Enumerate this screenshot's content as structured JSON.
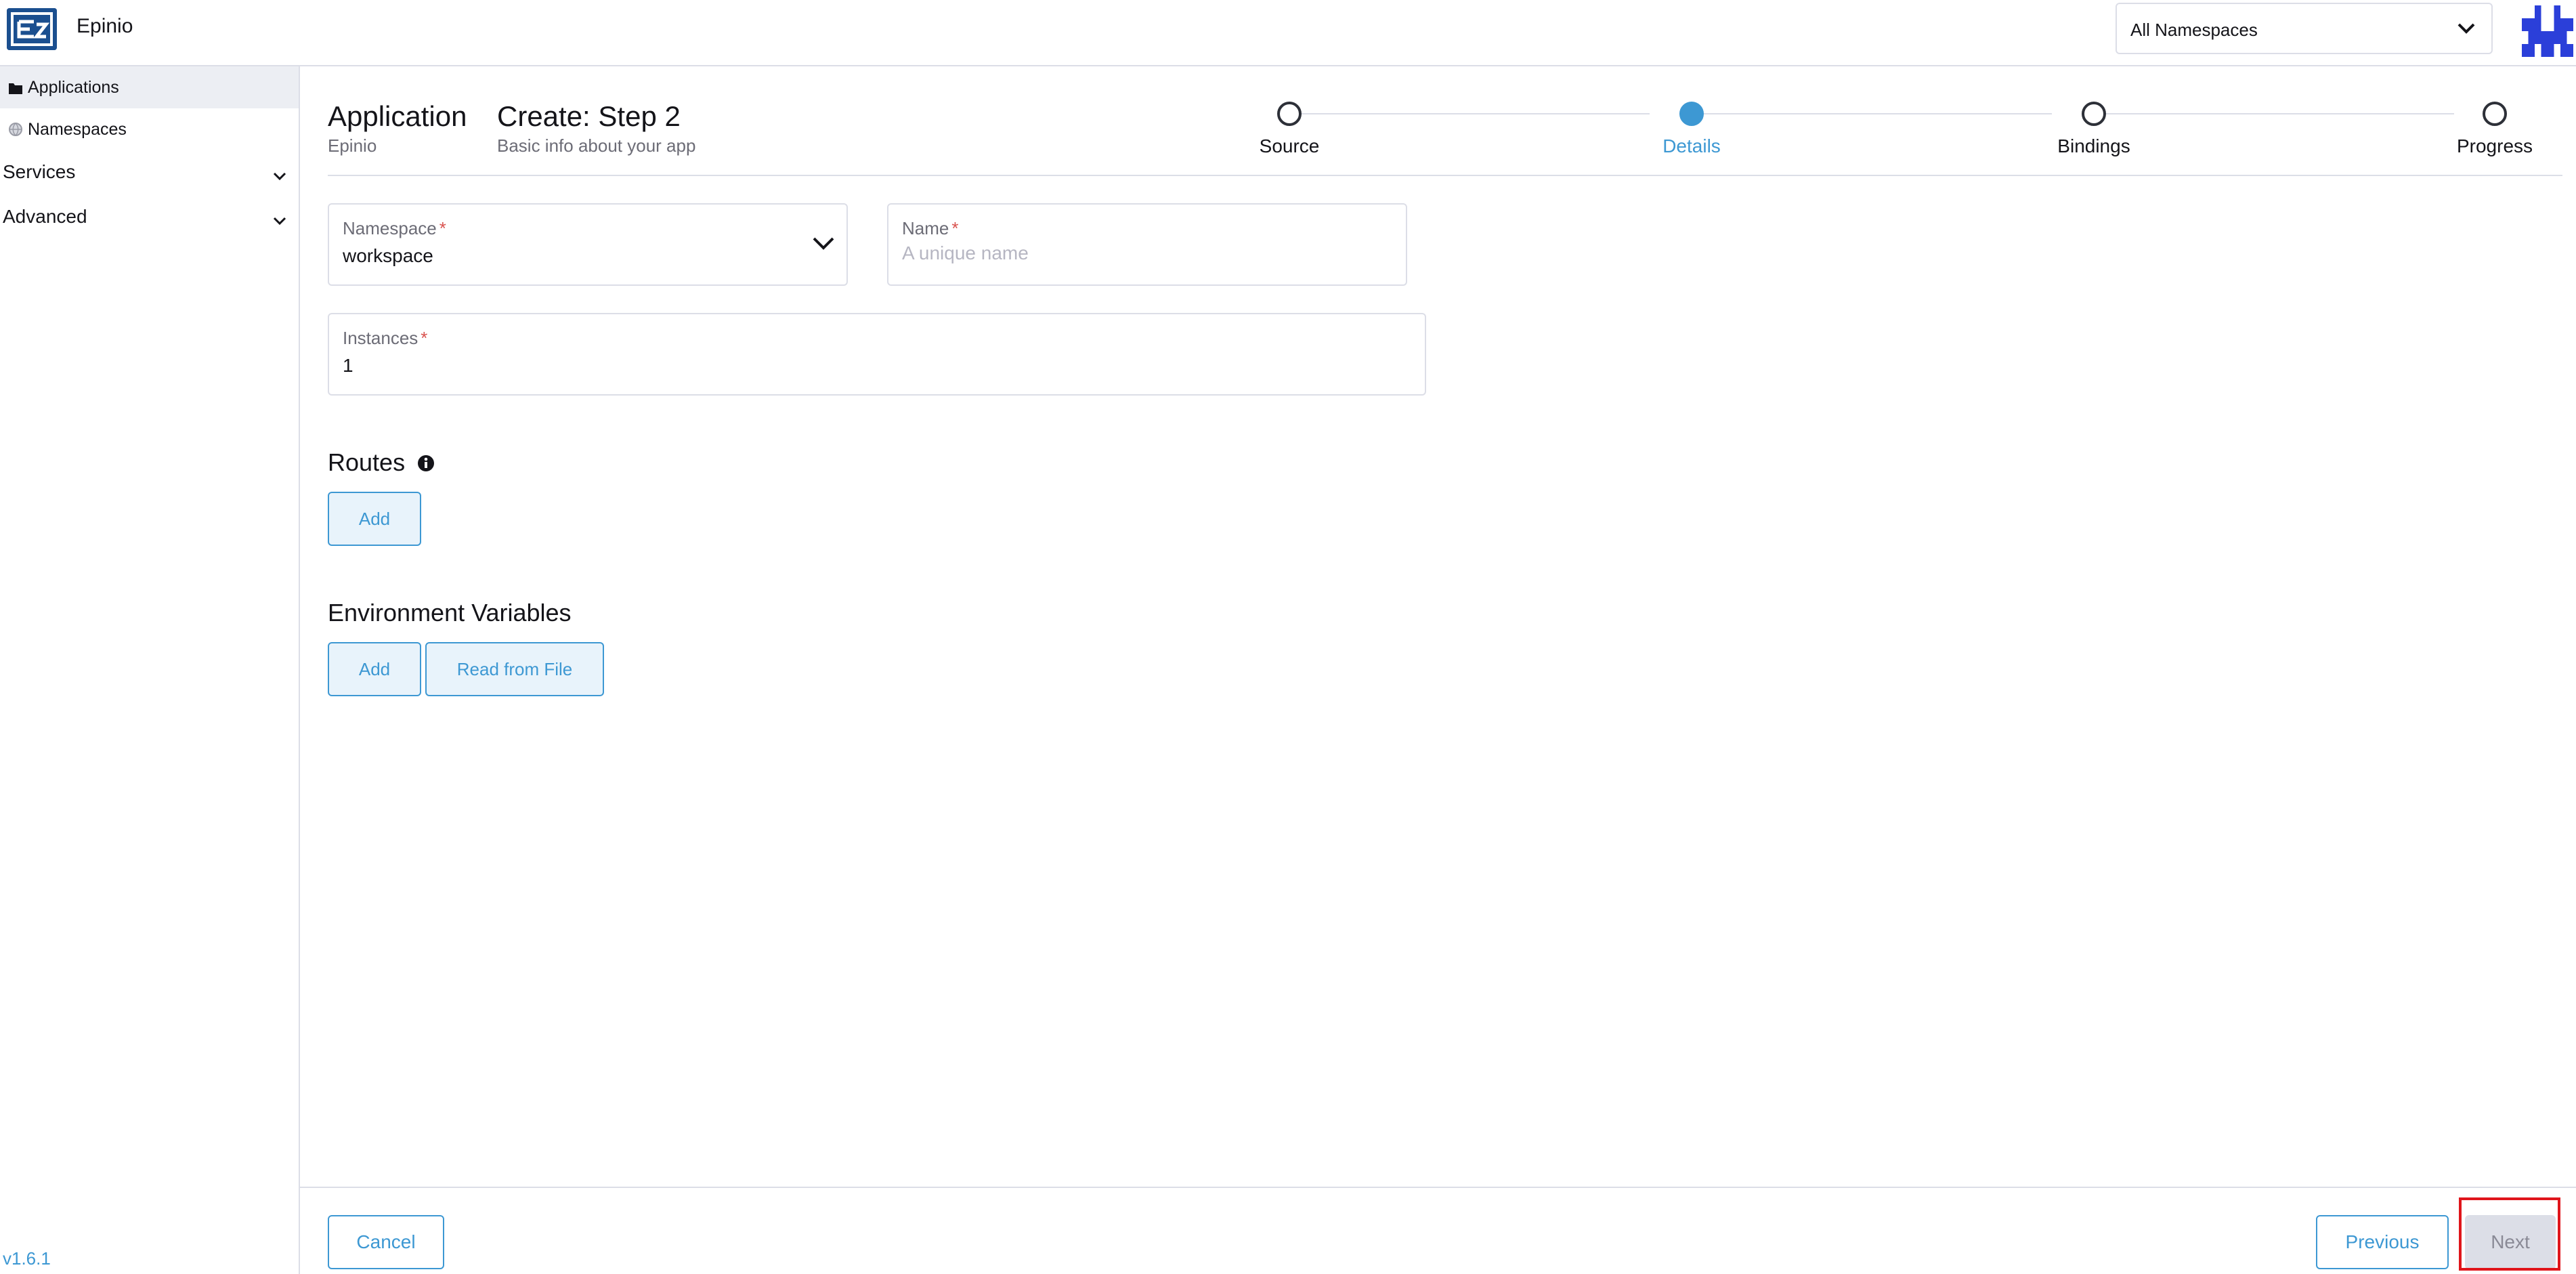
{
  "header": {
    "app_name": "Epinio",
    "namespace_filter": "All Namespaces"
  },
  "sidebar": {
    "items": [
      {
        "label": "Applications",
        "icon": "folder-icon",
        "active": true
      },
      {
        "label": "Namespaces",
        "icon": "globe-icon",
        "active": false
      }
    ],
    "groups": [
      {
        "label": "Services"
      },
      {
        "label": "Advanced"
      }
    ],
    "version": "v1.6.1"
  },
  "page": {
    "title": "Application",
    "subtitle": "Epinio",
    "step_title": "Create: Step 2",
    "step_subtitle": "Basic info about your app"
  },
  "stepper": {
    "steps": [
      {
        "label": "Source",
        "active": false
      },
      {
        "label": "Details",
        "active": true
      },
      {
        "label": "Bindings",
        "active": false
      },
      {
        "label": "Progress",
        "active": false
      }
    ]
  },
  "form": {
    "namespace": {
      "label": "Namespace",
      "required_mark": "*",
      "value": "workspace"
    },
    "name": {
      "label": "Name",
      "required_mark": "*",
      "placeholder": "A unique name",
      "value": ""
    },
    "instances": {
      "label": "Instances",
      "required_mark": "*",
      "value": "1"
    }
  },
  "routes": {
    "title": "Routes",
    "add_label": "Add"
  },
  "env_vars": {
    "title": "Environment Variables",
    "add_label": "Add",
    "read_file_label": "Read from File"
  },
  "footer": {
    "cancel_label": "Cancel",
    "previous_label": "Previous",
    "next_label": "Next"
  },
  "colors": {
    "accent": "#3d98d3",
    "highlight": "#e0151b",
    "border": "#dcdee7"
  }
}
